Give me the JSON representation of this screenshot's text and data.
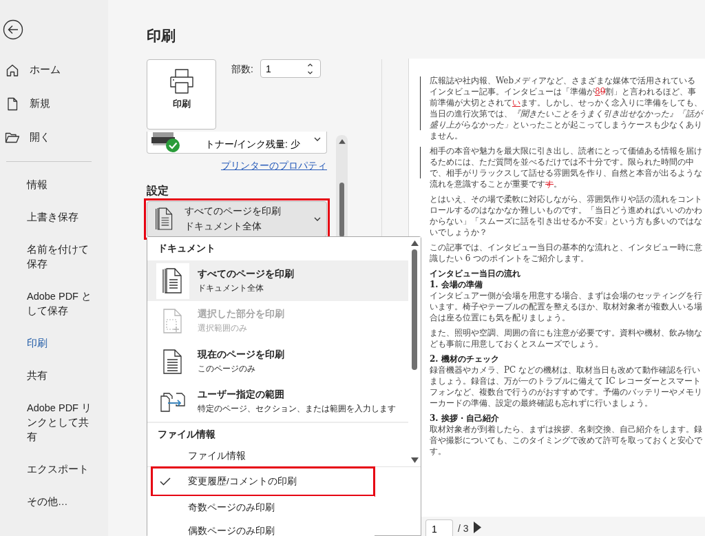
{
  "nav": {
    "primary_items": [
      {
        "label": "ホーム"
      },
      {
        "label": "新規"
      },
      {
        "label": "開く"
      }
    ],
    "items": [
      {
        "label": "情報",
        "selected": false
      },
      {
        "label": "上書き保存",
        "selected": false
      },
      {
        "label": "名前を付けて保存",
        "selected": false
      },
      {
        "label": "Adobe PDF として保存",
        "selected": false
      },
      {
        "label": "印刷",
        "selected": true
      },
      {
        "label": "共有",
        "selected": false
      },
      {
        "label": "Adobe PDF リンクとして共有",
        "selected": false
      },
      {
        "label": "エクスポート",
        "selected": false
      },
      {
        "label": "その他…",
        "selected": false
      }
    ]
  },
  "print": {
    "title": "印刷",
    "print_button": "印刷",
    "copies": {
      "label": "部数:",
      "value": "1"
    },
    "printer": {
      "status": "トナー/インク残量: 少"
    },
    "printer_properties": "プリンターのプロパティ",
    "settings_heading": "設定",
    "range_dropdown": {
      "title": "すべてのページを印刷",
      "subtitle": "ドキュメント全体",
      "highlighted": true,
      "expanded": true
    },
    "menu": {
      "sections": [
        {
          "heading": "ドキュメント",
          "items": [
            {
              "kind": "option",
              "title": "すべてのページを印刷",
              "subtitle": "ドキュメント全体",
              "selected": true,
              "disabled": false
            },
            {
              "kind": "option",
              "title": "選択した部分を印刷",
              "subtitle": "選択範囲のみ",
              "selected": false,
              "disabled": true
            },
            {
              "kind": "option",
              "title": "現在のページを印刷",
              "subtitle": "このページのみ",
              "selected": false,
              "disabled": false
            },
            {
              "kind": "option",
              "title": "ユーザー指定の範囲",
              "subtitle": "特定のページ、セクション、または範囲を入力します",
              "selected": false,
              "disabled": false
            }
          ]
        },
        {
          "heading": "ファイル情報",
          "items": [
            {
              "kind": "plain",
              "title": "ファイル情報"
            }
          ]
        }
      ],
      "check_items": [
        {
          "label": "変更履歴/コメントの印刷",
          "checked": true,
          "highlighted": true
        },
        {
          "label": "奇数ページのみ印刷",
          "checked": false,
          "highlighted": false
        },
        {
          "label": "偶数ページのみ印刷",
          "checked": false,
          "highlighted": false
        }
      ]
    }
  },
  "preview": {
    "blocks": [
      {
        "paragraphs": [
          {
            "kind": "body",
            "changed": true,
            "runs": [
              {
                "kind": "normal",
                "text": "広報誌や社内報、Webメディアなど、さまざまな媒体で活用されているインタビュー記事。インタビューは「準備が"
              },
              {
                "kind": "insert",
                "text": "8"
              },
              {
                "kind": "delete",
                "text": "9"
              },
              {
                "kind": "normal",
                "text": "割」と言われるほど、事前準備が大切とされて"
              },
              {
                "kind": "insert",
                "text": "い"
              },
              {
                "kind": "normal",
                "text": "ます。しかし、せっかく念入りに準備をしても、当日の進行次第では、"
              },
              {
                "kind": "italic",
                "text": "『聞きたいことをうまく引き出せなかった』「話が盛り上がらなかった」"
              },
              {
                "kind": "normal",
                "text": "といったことが起こってしまうケースも少なくありません。"
              }
            ]
          }
        ]
      },
      {
        "paragraphs": [
          {
            "kind": "body",
            "changed": true,
            "runs": [
              {
                "kind": "normal",
                "text": "相手の本音や魅力を最大限に引き出し、読者にとって価値ある情報を届けるためには、ただ質問を並べるだけでは不十分です。限られた時間の中で、相手がリラックスして話せる雰囲気を作り、自然と本音が出るような流れを意識することが重要です"
              },
              {
                "kind": "delete",
                "text": "す"
              },
              {
                "kind": "normal",
                "text": "。"
              }
            ]
          }
        ]
      },
      {
        "paragraphs": [
          {
            "kind": "body",
            "changed": false,
            "runs": [
              {
                "kind": "normal",
                "text": "とはいえ、その場で柔軟に対応しながら、雰囲気作りや話の流れをコントロールするのはなかなか難しいものです。「当日どう進めればいいのかわからない」「スムーズに話を引き出せるか不安」という方も多いのではないでしょうか？"
              }
            ]
          }
        ]
      },
      {
        "paragraphs": [
          {
            "kind": "body",
            "changed": false,
            "runs": [
              {
                "kind": "normal",
                "text": "この記事では、インタビュー当日の基本的な流れと、インタビュー時に意識したい 6 つのポイントをご紹介します。"
              }
            ]
          }
        ]
      },
      {
        "paragraphs": [
          {
            "kind": "heading",
            "changed": false,
            "runs": [
              {
                "kind": "normal",
                "text": "インタビュー当日の流れ"
              }
            ]
          },
          {
            "kind": "heading",
            "changed": false,
            "runs": [
              {
                "kind": "normal",
                "text": "1. 会場の準備"
              }
            ]
          },
          {
            "kind": "body",
            "changed": false,
            "runs": [
              {
                "kind": "normal",
                "text": "インタビュアー側が会場を用意する場合、まずは会場のセッティングを行います。椅子やテーブルの配置を整えるほか、取材対象者が複数人いる場合は座る位置にも気を配りましょう。"
              }
            ]
          }
        ]
      },
      {
        "paragraphs": [
          {
            "kind": "body",
            "changed": false,
            "runs": [
              {
                "kind": "normal",
                "text": "また、照明や空調、周囲の音にも注意が必要です。資料や機材、飲み物なども事前に用意しておくとスムーズでしょう。"
              }
            ]
          }
        ]
      },
      {
        "paragraphs": [
          {
            "kind": "heading",
            "changed": false,
            "runs": [
              {
                "kind": "normal",
                "text": "2. 機材のチェック"
              }
            ]
          },
          {
            "kind": "body",
            "changed": false,
            "runs": [
              {
                "kind": "normal",
                "text": "録音機器やカメラ、PC などの機材は、取材当日も改めて動作確認を行いましょう。録音は、万が一のトラブルに備えて IC レコーダーとスマートフォンなど、複数台で行うのがおすすめです。予備のバッテリーやメモリーカードの準備、設定の最終確認も忘れずに行いましょう。"
              }
            ]
          }
        ]
      },
      {
        "paragraphs": [
          {
            "kind": "heading",
            "changed": false,
            "runs": [
              {
                "kind": "normal",
                "text": "3. 挨拶・自己紹介"
              }
            ]
          },
          {
            "kind": "body",
            "changed": false,
            "runs": [
              {
                "kind": "normal",
                "text": "取材対象者が到着したら、まずは挨拶、名刺交換、自己紹介をします。録音や撮影についても、このタイミングで改めて許可を取っておくと安心です。"
              }
            ]
          }
        ]
      }
    ],
    "page_nav": {
      "current": "1",
      "total": "/ 3"
    }
  }
}
